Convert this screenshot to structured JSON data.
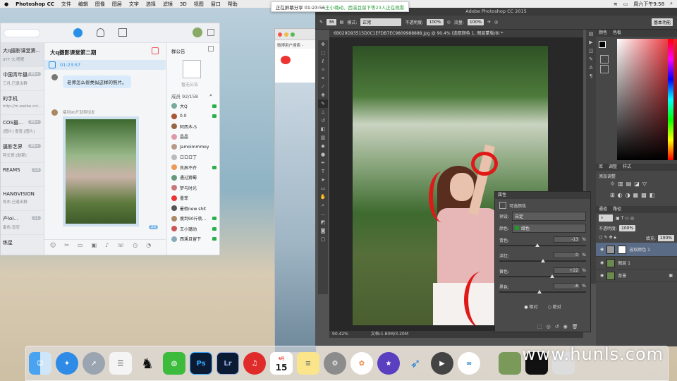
{
  "menubar": {
    "app_name": "Photoshop CC",
    "items": [
      "文件",
      "编辑",
      "图像",
      "图层",
      "文字",
      "选择",
      "滤镜",
      "3D",
      "视图",
      "窗口",
      "帮助"
    ],
    "clock": "周六下午9:58"
  },
  "share_banner": {
    "prefix": "正在屏幕分享 01:23:56",
    "names": "王小璐动、西溪且留下等23人正在观看"
  },
  "qq": {
    "group_title": "大q摄影课堂第二期",
    "notice_title": "群公告",
    "notice_empty": "暂无公告",
    "timer": "01:23:57",
    "message": "老师怎么修类似这样的照片。",
    "sender": "瘦到90斤就剪短发",
    "unread_badge": "23",
    "members_title": "成员 92/158",
    "chat_list": [
      {
        "name": "大q摄影课堂第...",
        "sub": "dYY 大:嗯嗯",
        "badge": ""
      },
      {
        "name": "中国青年摄...",
        "sub": "三月,已退出群",
        "badge": "99+"
      },
      {
        "name": "的手机",
        "sub": "http://m.weibo.cn/...",
        "badge": ""
      },
      {
        "name": "COS摄...",
        "sub": "[图片] 雪查:[图片]",
        "badge": "99+"
      },
      {
        "name": "摄影艺界",
        "sub": "阿长哥:[鼓掌]",
        "badge": "99+"
      },
      {
        "name": "REAMS",
        "sub": "",
        "badge": "10"
      },
      {
        "name": "HANGVISION",
        "sub": "将东,已退出群",
        "badge": ""
      },
      {
        "name": "产loi...",
        "sub": "夏色:没空",
        "badge": "11"
      },
      {
        "name": "练星",
        "sub": "",
        "badge": ""
      }
    ],
    "members": [
      "大Q",
      "0.0",
      "阿西木-S",
      "晶晶",
      "Jamoimmmoy",
      "ロロロ丁",
      "良辰不齐",
      "遇过猜蜀",
      "梦与时光",
      "墨菲",
      "暑假new shit",
      "瘦到90斤就...",
      "王小璐动",
      "西溪且留下"
    ]
  },
  "browser": {
    "tab_label": "微博用户搜索 -"
  },
  "photoshop": {
    "window_title": "Adobe Photoshop CC 2015",
    "doc_tab": "6B029D93515D0C1EFDB7EC9809988888.jpg @ 90.4% (选取颜色 1, 图层蒙版/8) *",
    "mode_label": "模式:",
    "mode_value": "正常",
    "opacity_label": "不透明度:",
    "opacity_value": "100%",
    "flow_label": "流量:",
    "flow_value": "100%",
    "workspace": "基本功能",
    "brush_size": "36",
    "zoom": "90.42%",
    "doc_info": "文档:1.80M/3.20M",
    "color_tabs": [
      "颜色",
      "色板"
    ],
    "library_tabs": [
      "库",
      "调整",
      "样式"
    ],
    "adjust_label": "添加调整",
    "layer_tabs": [
      "通道",
      "路径"
    ],
    "layer_opacity_label": "不透明度:",
    "layer_opacity": "100%",
    "fill_label": "填充:",
    "fill": "100%",
    "layers": [
      "选取颜色 1",
      "图层 1",
      "背景"
    ]
  },
  "properties": {
    "title": "属性",
    "adj_name": "可选颜色",
    "preset_label": "预设:",
    "preset_value": "自定",
    "colors_label": "颜色:",
    "colors_value": "绿色",
    "sliders": [
      {
        "label": "青色:",
        "value": "-13",
        "frac": 0.435
      },
      {
        "label": "洋红:",
        "value": "0",
        "frac": 0.5
      },
      {
        "label": "黄色:",
        "value": "+22",
        "frac": 0.61
      },
      {
        "label": "黑色:",
        "value": "-8",
        "frac": 0.46
      }
    ],
    "unit": "%",
    "relative": "相对",
    "absolute": "绝对"
  },
  "dock": {
    "calendar_month": "4月",
    "calendar_day": "15",
    "apps": [
      "finder-icon",
      "safari-icon",
      "launchpad-icon",
      "reminders-icon",
      "qq-icon",
      "wechat-icon",
      "photoshop-icon",
      "lightroom-icon",
      "netease-music-icon",
      "calendar-icon",
      "notes-icon",
      "system-prefs-icon",
      "photos-icon",
      "imovie-icon",
      "xunlei-icon",
      "quicktime-icon",
      "baidu-cloud-icon"
    ]
  },
  "watermark": "www.hunls.com"
}
